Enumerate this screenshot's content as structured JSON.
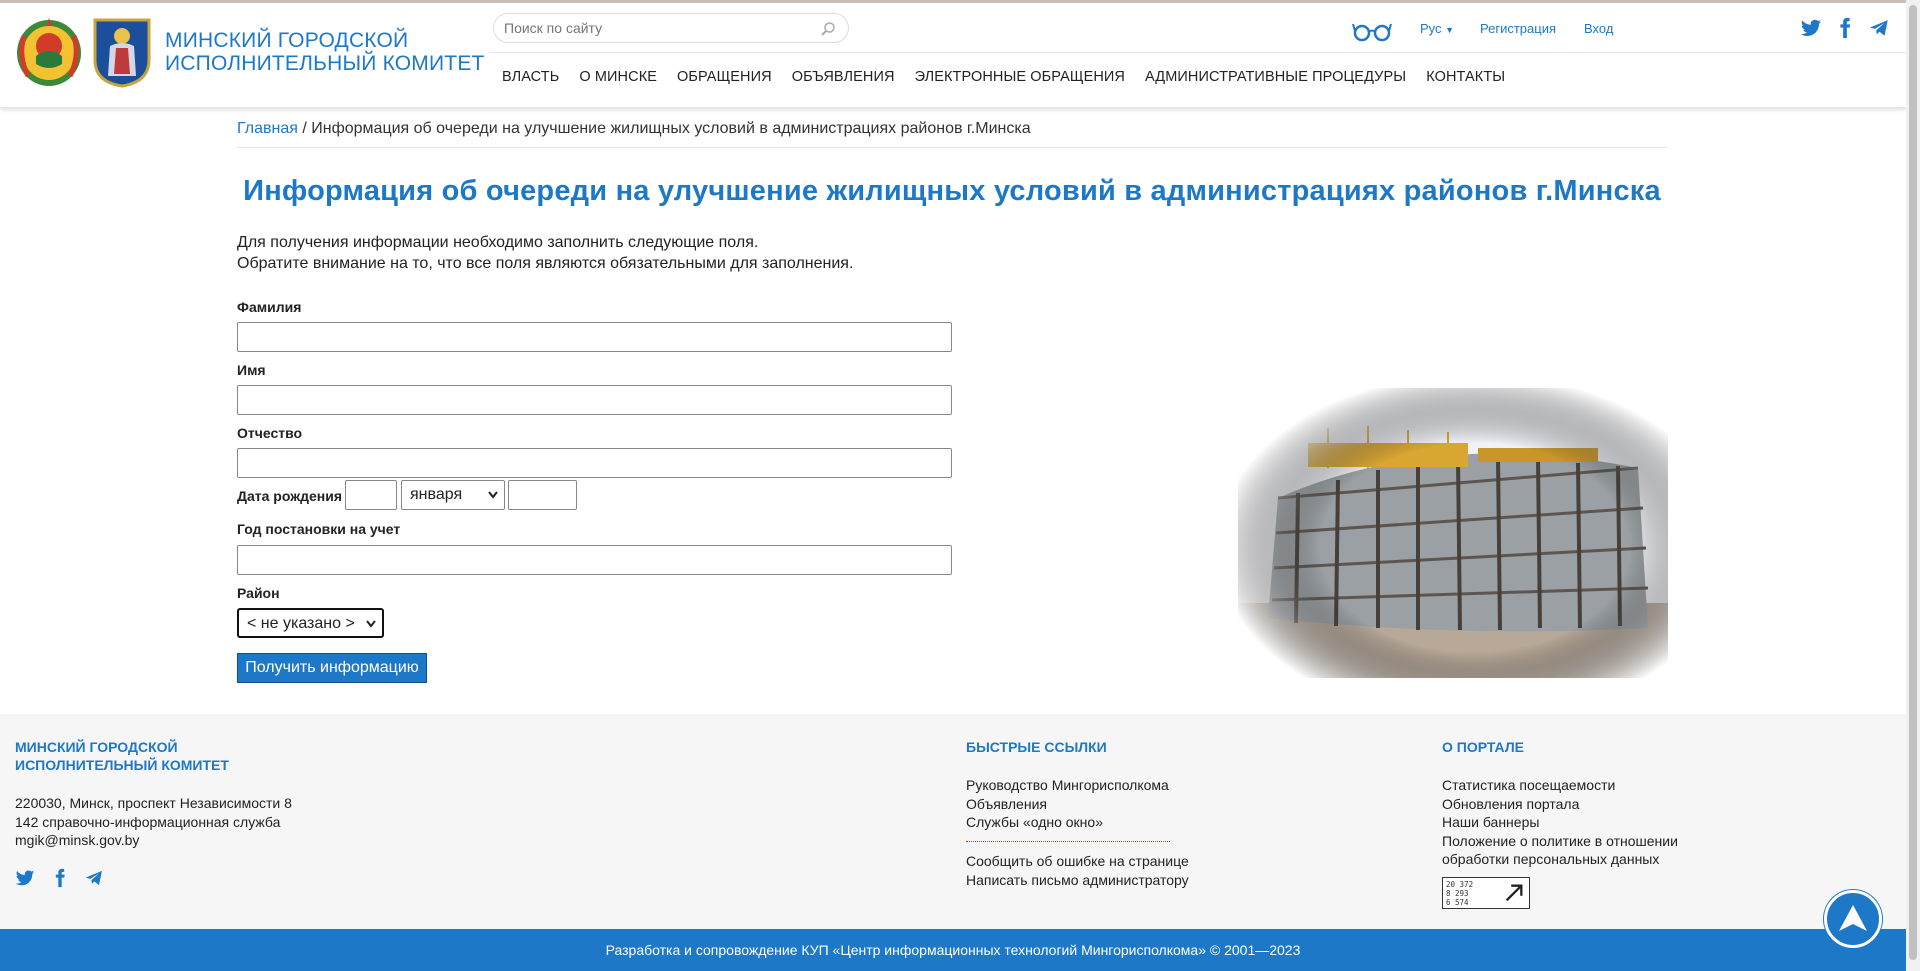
{
  "header": {
    "org_title_line1": "Минский городской",
    "org_title_line2": "исполнительный комитет",
    "search_placeholder": "Поиск по сайту",
    "lang": "Рус",
    "register": "Регистрация",
    "login": "Вход",
    "nav": [
      "ВЛАСТЬ",
      "О МИНСКЕ",
      "ОБРАЩЕНИЯ",
      "ОБЪЯВЛЕНИЯ",
      "ЭЛЕКТРОННЫЕ ОБРАЩЕНИЯ",
      "АДМИНИСТРАТИВНЫЕ ПРОЦЕДУРЫ",
      "КОНТАКТЫ"
    ]
  },
  "breadcrumb": {
    "home": "Главная",
    "separator": " / ",
    "current": "Информация об очереди на улучшение жилищных условий в администрациях районов г.Минска"
  },
  "page": {
    "title": "Информация об очереди на улучшение жилищных условий в администрациях районов г.Минска",
    "intro_line1": "Для получения информации необходимо заполнить следующие поля.",
    "intro_line2": "Обратите внимание на то, что все поля являются обязательными для заполнения."
  },
  "form": {
    "surname_label": "Фамилия",
    "name_label": "Имя",
    "patronymic_label": "Отчество",
    "birthdate_label": "Дата рождения",
    "birth_month": "января",
    "year_label": "Год постановки на учет",
    "district_label": "Район",
    "district_value": "< не указано >",
    "submit_label": "Получить информацию"
  },
  "footer": {
    "org_line1": "МИНСКИЙ ГОРОДСКОЙ",
    "org_line2": "ИСПОЛНИТЕЛЬНЫЙ КОМИТЕТ",
    "address": "220030, Минск, проспект Независимости 8",
    "phone": "142 справочно-информационная служба",
    "email": "mgik@minsk.gov.by",
    "quick_links_title": "БЫСТРЫЕ ССЫЛКИ",
    "quick_links": [
      "Руководство Мингорисполкома",
      "Объявления",
      "Службы «одно окно»"
    ],
    "extra_links": [
      "Сообщить об ошибке на странице",
      "Написать письмо администратору"
    ],
    "about_title": "О ПОРТАЛЕ",
    "about_links": [
      "Статистика посещаемости",
      "Обновления портала",
      "Наши баннеры",
      "Положение о политике в отношении",
      "обработки персональных данных"
    ],
    "counter": [
      "20 372",
      "8 293",
      "6 574"
    ],
    "copyright": "Разработка и сопровождение КУП «Центр информационных технологий Мингорисполкома» © 2001—2023"
  },
  "colors": {
    "accent": "#1e78c8",
    "footer_bg": "#f6f6f6"
  },
  "icons": {
    "search": "search-icon",
    "glasses": "glasses-icon",
    "twitter": "twitter-icon",
    "facebook": "facebook-icon",
    "telegram": "telegram-icon",
    "up": "arrow-up-icon"
  }
}
